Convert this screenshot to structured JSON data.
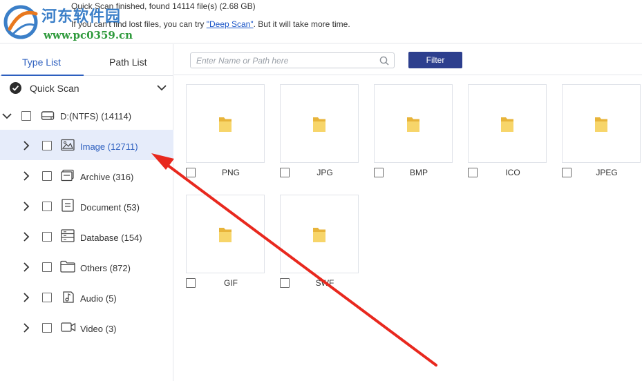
{
  "header": {
    "status": "Quick Scan finished, found 14114 file(s) (2.68 GB)",
    "hint_before": "If you can't find lost files, you can try ",
    "deep_scan_link": "\"Deep Scan\"",
    "hint_after": ". But it will take more time."
  },
  "watermark": {
    "title": "河东软件园",
    "url": "www.pc0359.cn"
  },
  "sidebar": {
    "tabs": [
      {
        "label": "Type List",
        "active": true
      },
      {
        "label": "Path List",
        "active": false
      }
    ],
    "scan_mode": "Quick Scan",
    "drive": "D:(NTFS) (14114)",
    "items": [
      {
        "label": "Image (12711)",
        "icon": "image-icon",
        "selected": true
      },
      {
        "label": "Archive (316)",
        "icon": "archive-icon",
        "selected": false
      },
      {
        "label": "Document (53)",
        "icon": "document-icon",
        "selected": false
      },
      {
        "label": "Database (154)",
        "icon": "database-icon",
        "selected": false
      },
      {
        "label": "Others (872)",
        "icon": "folder-icon",
        "selected": false
      },
      {
        "label": "Audio (5)",
        "icon": "audio-icon",
        "selected": false
      },
      {
        "label": "Video (3)",
        "icon": "video-icon",
        "selected": false
      }
    ]
  },
  "search": {
    "placeholder": "Enter Name or Path here",
    "value": ""
  },
  "filter_button": "Filter",
  "tiles": [
    {
      "label": "PNG"
    },
    {
      "label": "JPG"
    },
    {
      "label": "BMP"
    },
    {
      "label": "ICO"
    },
    {
      "label": "JPEG"
    },
    {
      "label": "GIF"
    },
    {
      "label": "SWF"
    }
  ],
  "colors": {
    "accent": "#2d5fbf",
    "filter_button": "#2d3f8e",
    "selected_row": "#e6ecfa",
    "annotation_arrow": "#e8281e",
    "folder": "#f2c744"
  }
}
